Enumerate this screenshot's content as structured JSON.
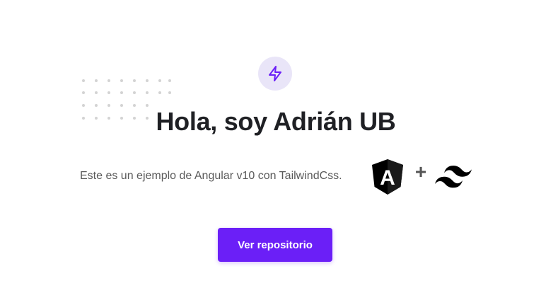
{
  "hero": {
    "icon": "lightning-bolt-icon",
    "title": "Hola, soy Adrián UB",
    "subtitle": "Este es un ejemplo de Angular v10 con TailwindCss.",
    "plus": "+",
    "angular_logo_letter": "A",
    "button_label": "Ver repositorio"
  },
  "colors": {
    "accent": "#6b1ff7",
    "badge_bg": "#e9e5f8",
    "title": "#1f2024",
    "text": "#5a5a5a"
  }
}
